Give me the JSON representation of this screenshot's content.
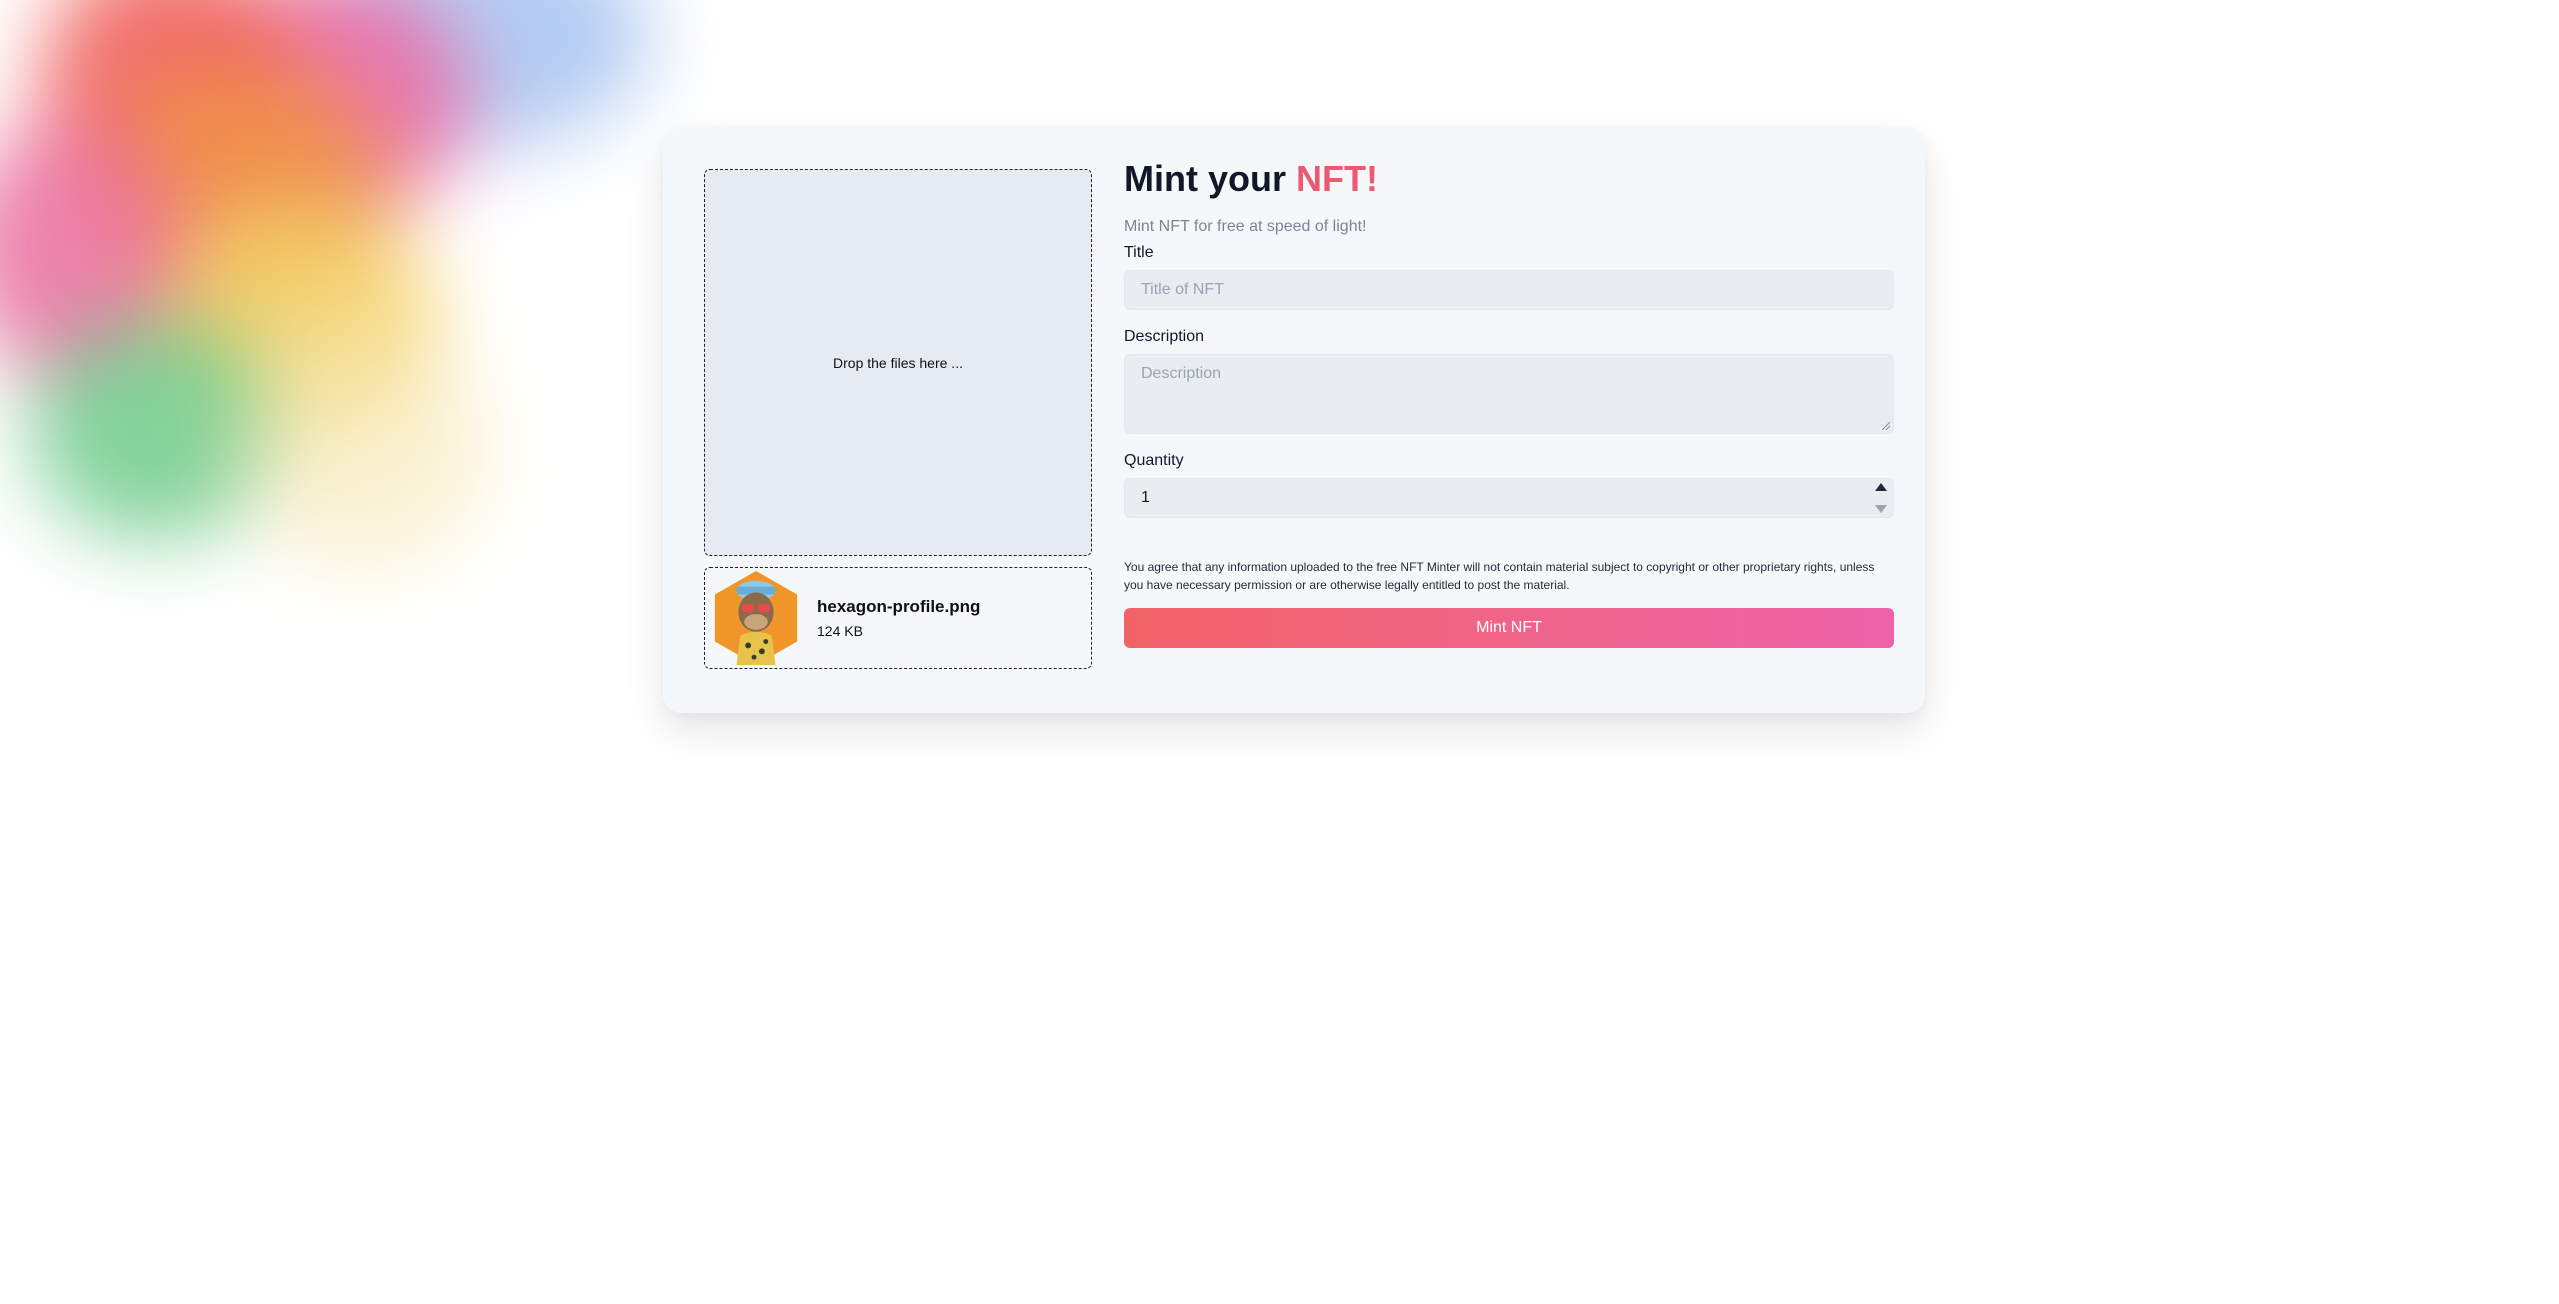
{
  "colors": {
    "accent": "#ec5a72",
    "button_gradient_start": "#f26368",
    "button_gradient_end": "#ec63a8",
    "card_bg": "#f5f8fb",
    "input_bg": "#e9edf2"
  },
  "dropzone": {
    "text": "Drop the files here ..."
  },
  "file": {
    "name": "hexagon-profile.png",
    "size": "124 KB",
    "thumbnail_icon": "hexagon-ape-avatar-icon"
  },
  "header": {
    "title_prefix": "Mint your",
    "title_accent": "NFT!",
    "subtitle": "Mint NFT for free at speed of light!"
  },
  "form": {
    "title_label": "Title",
    "title_placeholder": "Title of NFT",
    "description_label": "Description",
    "description_placeholder": "Description",
    "quantity_label": "Quantity",
    "quantity_value": "1"
  },
  "legal": {
    "text": "You agree that any information uploaded to the free NFT Minter will not contain material subject to copyright or other proprietary rights, unless you have necessary permission or are otherwise legally entitled to post the material."
  },
  "actions": {
    "mint_label": "Mint NFT"
  }
}
